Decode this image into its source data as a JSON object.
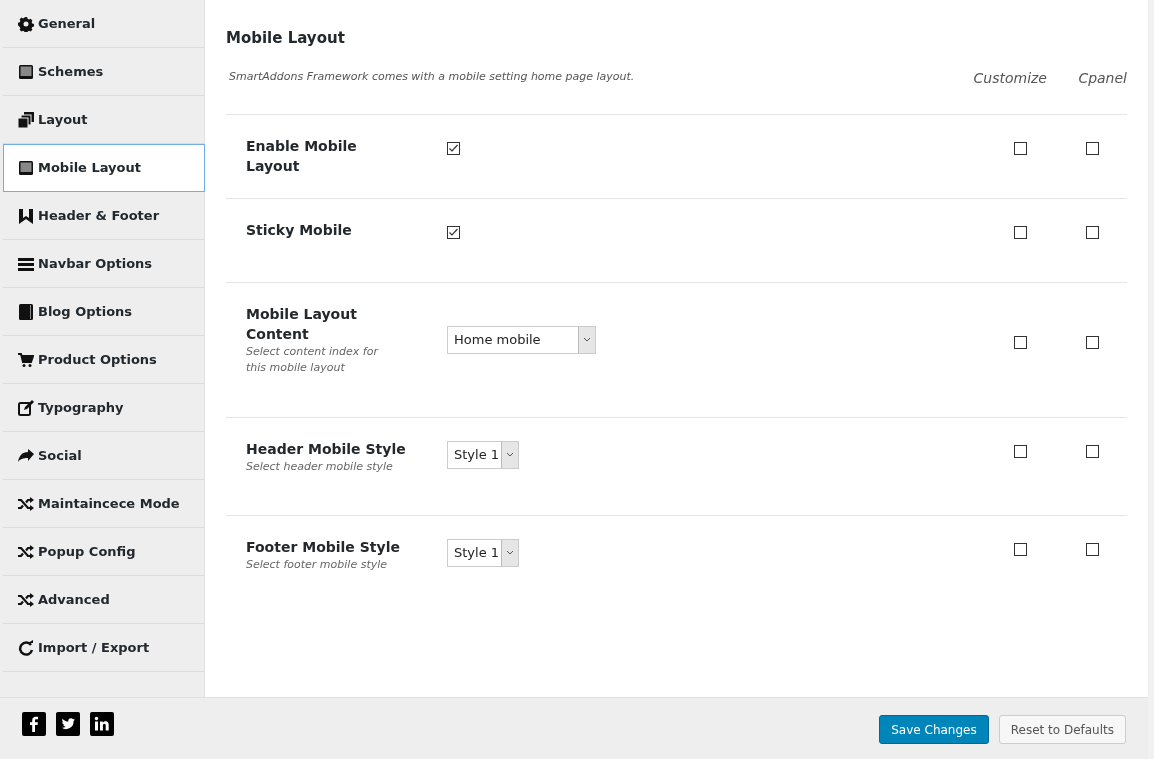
{
  "sidebar": {
    "items": [
      {
        "label": "General",
        "selected": false
      },
      {
        "label": "Schemes",
        "selected": false
      },
      {
        "label": "Layout",
        "selected": false
      },
      {
        "label": "Mobile Layout",
        "selected": true
      },
      {
        "label": "Header & Footer",
        "selected": false
      },
      {
        "label": "Navbar Options",
        "selected": false
      },
      {
        "label": "Blog Options",
        "selected": false
      },
      {
        "label": "Product Options",
        "selected": false
      },
      {
        "label": "Typography",
        "selected": false
      },
      {
        "label": "Social",
        "selected": false
      },
      {
        "label": "Maintaincece Mode",
        "selected": false
      },
      {
        "label": "Popup Config",
        "selected": false
      },
      {
        "label": "Advanced",
        "selected": false
      },
      {
        "label": "Import / Export",
        "selected": false
      }
    ]
  },
  "section": {
    "title": "Mobile Layout",
    "description": "SmartAddons Framework comes with a mobile setting home page layout.",
    "columns": [
      "Customize",
      "Cpanel"
    ]
  },
  "settings": [
    {
      "kind": "checkbox",
      "label": "Enable Mobile Layout",
      "checked": true,
      "customize": false,
      "cpanel": false
    },
    {
      "kind": "checkbox",
      "label": "Sticky Mobile",
      "checked": true,
      "customize": false,
      "cpanel": false
    },
    {
      "kind": "select",
      "label": "Mobile Layout Content",
      "hint": "Select content index for this mobile layout",
      "value": "Home mobile",
      "wide": true,
      "customize": false,
      "cpanel": false
    },
    {
      "kind": "select",
      "label": "Header Mobile Style",
      "hint": "Select header mobile style",
      "value": "Style 1",
      "wide": false,
      "customize": false,
      "cpanel": false
    },
    {
      "kind": "select",
      "label": "Footer Mobile Style",
      "hint": "Select footer mobile style",
      "value": "Style 1",
      "wide": false,
      "customize": false,
      "cpanel": false
    }
  ],
  "footer": {
    "buttons": [
      {
        "label": "Save Changes",
        "primary": true
      },
      {
        "label": "Reset to Defaults",
        "primary": false
      }
    ]
  }
}
